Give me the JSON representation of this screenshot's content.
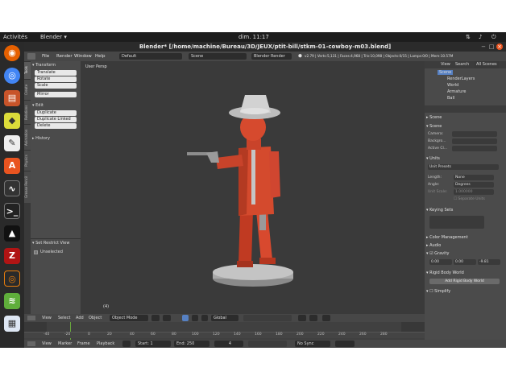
{
  "topbar": {
    "activities": "Activités",
    "app_menu": "Blender ▾",
    "clock": "dim. 11:17"
  },
  "window": {
    "title": "Blender* [/home/machine/Bureau/3D/JEUX/ptit-bill/stkm-01-cowboy-m03.blend]"
  },
  "blender_menu": {
    "items": [
      "File",
      "Render",
      "Window",
      "Help"
    ],
    "layout": "Default",
    "scene": "Scene",
    "engine": "Blender Render",
    "stats": "v2.79 | Verts:5,131 | Faces:4,968 | Tris:10,098 | Objects:0/15 | Lamps:0/0 | Mem:10.57M"
  },
  "tool_tabs": [
    "Tools",
    "Create",
    "Relations",
    "Animation",
    "Physics",
    "Grease Pencil"
  ],
  "tool_shelf": {
    "transform_header": "Transform",
    "transform_buttons": [
      "Translate",
      "Rotate",
      "Scale",
      "Mirror"
    ],
    "edit_header": "Edit",
    "edit_buttons": [
      "Duplicate",
      "Duplicate Linked",
      "Delete"
    ],
    "history_header": "History",
    "restrict_header": "Set Restrict View",
    "unselected": "Unselected"
  },
  "viewport": {
    "label": "User Persp",
    "frame": "(4)"
  },
  "viewport_header": {
    "items": [
      "View",
      "Select",
      "Add",
      "Object"
    ],
    "mode": "Object Mode",
    "orientation": "Global"
  },
  "outliner": {
    "tabs": [
      "View",
      "Search",
      "All Scenes"
    ],
    "rows": [
      "Scene",
      "RenderLayers",
      "World",
      "Armature",
      "Ball"
    ]
  },
  "properties": {
    "scene_label": "Scene",
    "scene_header": "Scene",
    "camera_label": "Camera:",
    "background_label": "Backgro...",
    "active_clip_label": "Active Cl...",
    "units_header": "Units",
    "unit_presets": "Unit Presets",
    "length_label": "Length:",
    "length_value": "None",
    "angle_label": "Angle:",
    "angle_value": "Degrees",
    "unit_scale_label": "Unit Scale:",
    "unit_scale_value": "1.000000",
    "separate_units": "Separate Units",
    "keying_header": "Keying Sets",
    "color_mgmt_header": "Color Management",
    "audio_header": "Audio",
    "gravity_header": "Gravity",
    "gravity_values": [
      "0.00",
      "0.00",
      "-9.81"
    ],
    "rigid_header": "Rigid Body World",
    "add_rigid_button": "Add Rigid Body World",
    "simplify_header": "Simplify"
  },
  "timeline": {
    "ticks": [
      "-40",
      "-20",
      "0",
      "20",
      "40",
      "60",
      "80",
      "100",
      "120",
      "140",
      "160",
      "180",
      "200",
      "220",
      "240",
      "260",
      "280"
    ],
    "menu": [
      "View",
      "Marker",
      "Frame",
      "Playback"
    ],
    "start_label": "Start:",
    "start_value": "1",
    "end_label": "End:",
    "end_value": "250",
    "current_frame": "4",
    "sync": "No Sync"
  },
  "colors": {
    "figure_red": "#d0452a",
    "ground": "#b9b9b9",
    "hat": "#c9c9c9",
    "accent_blue": "#5680c2"
  }
}
